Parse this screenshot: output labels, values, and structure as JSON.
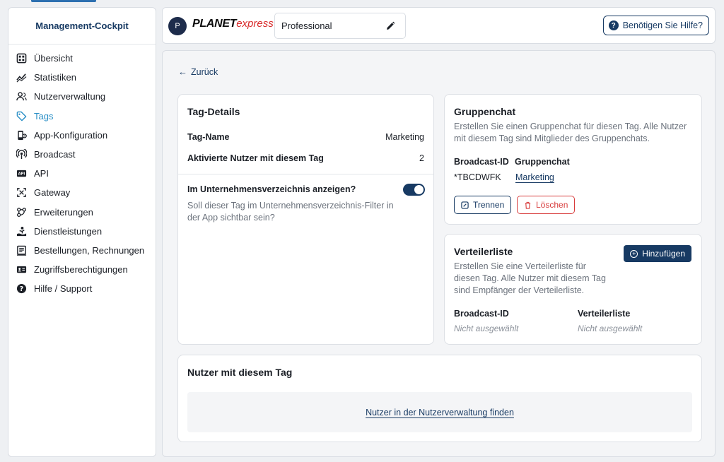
{
  "sidebar": {
    "title": "Management-Cockpit",
    "items": [
      {
        "label": "Übersicht",
        "icon": "grid-icon"
      },
      {
        "label": "Statistiken",
        "icon": "chart-icon"
      },
      {
        "label": "Nutzerverwaltung",
        "icon": "users-icon"
      },
      {
        "label": "Tags",
        "icon": "tag-icon",
        "active": true
      },
      {
        "label": "App-Konfiguration",
        "icon": "phone-settings-icon"
      },
      {
        "label": "Broadcast",
        "icon": "broadcast-icon"
      },
      {
        "label": "API",
        "icon": "api-icon"
      },
      {
        "label": "Gateway",
        "icon": "gateway-icon"
      },
      {
        "label": "Erweiterungen",
        "icon": "extensions-icon"
      },
      {
        "label": "Dienstleistungen",
        "icon": "services-icon"
      },
      {
        "label": "Bestellungen, Rechnungen",
        "icon": "receipt-icon"
      },
      {
        "label": "Zugriffsberechtigungen",
        "icon": "id-card-icon"
      },
      {
        "label": "Hilfe / Support",
        "icon": "help-icon"
      }
    ]
  },
  "header": {
    "avatar_letter": "P",
    "brand_part1": "PLANET",
    "brand_part2": "express",
    "plan": "Professional",
    "help_label": "Benötigen Sie Hilfe?"
  },
  "main": {
    "back_label": "Zurück",
    "tag_details": {
      "title": "Tag-Details",
      "name_label": "Tag-Name",
      "name_value": "Marketing",
      "users_label": "Aktivierte Nutzer mit diesem Tag",
      "users_value": "2",
      "directory_question": "Im Unternehmensverzeichnis anzeigen?",
      "directory_desc": "Soll dieser Tag im Unternehmensverzeichnis-Filter in der App sichtbar sein?",
      "directory_enabled": true
    },
    "groupchat": {
      "title": "Gruppenchat",
      "desc": "Erstellen Sie einen Gruppenchat für diesen Tag. Alle Nutzer mit diesem Tag sind Mitglieder des Gruppenchats.",
      "col1_header": "Broadcast-ID",
      "col2_header": "Gruppenchat",
      "broadcast_id": "*TBCDWFK",
      "chat_name": "Marketing",
      "disconnect_label": "Trennen",
      "delete_label": "Löschen"
    },
    "distribution": {
      "title": "Verteilerliste",
      "desc": "Erstellen Sie eine Verteilerliste für diesen Tag. Alle Nutzer mit diesem Tag sind Empfänger der Verteilerliste.",
      "add_label": "Hinzufügen",
      "col1_header": "Broadcast-ID",
      "col2_header": "Verteilerliste",
      "col1_value": "Nicht ausgewählt",
      "col2_value": "Nicht ausgewählt"
    },
    "users": {
      "title": "Nutzer mit diesem Tag",
      "link": "Nutzer in der Nutzerverwaltung finden"
    }
  },
  "colors": {
    "primary": "#173a63",
    "active_nav": "#2a8fc6",
    "danger": "#d83c3c",
    "brand_red": "#d82a2a"
  }
}
